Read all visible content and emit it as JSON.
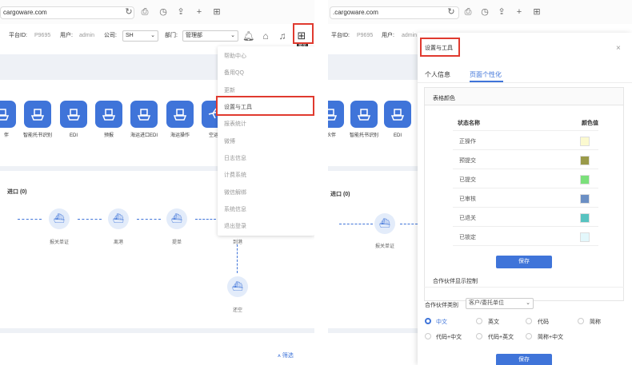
{
  "left": {
    "url": "cargoware.com",
    "platform_id_label": "平台ID:",
    "platform_id": "P9695",
    "user_label": "用户:",
    "user": "admin",
    "company_label": "公司:",
    "company": "SH",
    "dept_label": "部门:",
    "dept": "管理部",
    "menu_tooltip": "菜单",
    "tiles": [
      {
        "label": "伴"
      },
      {
        "label": "智能托书识别"
      },
      {
        "label": "EDI"
      },
      {
        "label": "预报"
      },
      {
        "label": "海运进口EDI"
      },
      {
        "label": "海运操作"
      },
      {
        "label": "空运"
      }
    ],
    "section_title": "进口 (0)",
    "nodes": {
      "n2": "报关单证",
      "n3": "离港",
      "n4": "提单",
      "n5": "到港",
      "n6": "还空"
    },
    "filter": "筛选",
    "menu_items": [
      "帮助中心",
      "备用QQ",
      "更新",
      "设置与工具",
      "报表统计",
      "微博",
      "日志信息",
      "计费系统",
      "微信解绑",
      "系统信息",
      "退出登录"
    ]
  },
  "right": {
    "url": ".cargoware.com",
    "platform_id_label": "平台ID:",
    "platform_id": "P9695",
    "user_label": "用户:",
    "user": "admin",
    "tiles": [
      {
        "label": "伙伴"
      },
      {
        "label": "智能托书识别"
      },
      {
        "label": "EDI"
      }
    ],
    "section_title": "进口 (0)",
    "nodes": {
      "n2": "报关单证"
    },
    "modal": {
      "title": "设置与工具",
      "close": "×",
      "tab_personal": "个人信息",
      "tab_page": "页面个性化",
      "table_color": "表格颜色",
      "col_status": "状态名称",
      "col_color": "颜色值",
      "rows": [
        {
          "name": "正操作",
          "color": "#fbf9cf"
        },
        {
          "name": "预提交",
          "color": "#9a9a49"
        },
        {
          "name": "已提交",
          "color": "#7be07b"
        },
        {
          "name": "已审核",
          "color": "#6b8fc4"
        },
        {
          "name": "已退关",
          "color": "#57c3c0"
        },
        {
          "name": "已锁定",
          "color": "#e3f7fb"
        }
      ],
      "save": "保存",
      "partner_ctrl": "合作伙伴显示控制",
      "partner_type_label": "合作伙伴类别",
      "partner_type_value": "客户/委托单位",
      "options": [
        "中文",
        "英文",
        "代码",
        "简称",
        "代码+中文",
        "代码+英文",
        "简称+中文"
      ],
      "save2": "保存"
    }
  },
  "colors": {
    "accent": "#3f74d9",
    "highlight": "#e03a2f"
  }
}
